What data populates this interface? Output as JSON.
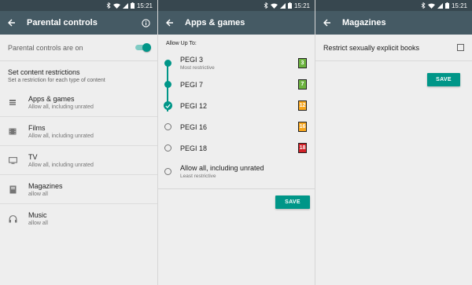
{
  "status_time": "15:21",
  "colors": {
    "status_bar": "#37474f",
    "app_bar": "#455a64",
    "accent": "#009688"
  },
  "panel1": {
    "title": "Parental controls",
    "toggle_label": "Parental controls are on",
    "toggle_on": true,
    "section_title": "Set content restrictions",
    "section_sub": "Set a restriction for each type of content",
    "items": [
      {
        "icon": "apps-icon",
        "label": "Apps & games",
        "sub": "Allow all, including unrated"
      },
      {
        "icon": "films-icon",
        "label": "Films",
        "sub": "Allow all, including unrated"
      },
      {
        "icon": "tv-icon",
        "label": "TV",
        "sub": "Allow all, including unrated"
      },
      {
        "icon": "book-icon",
        "label": "Magazines",
        "sub": "allow all"
      },
      {
        "icon": "headphones-icon",
        "label": "Music",
        "sub": "allow all"
      }
    ]
  },
  "panel2": {
    "title": "Apps & games",
    "allow_label": "Allow Up To:",
    "ratings": [
      {
        "label": "PEGI 3",
        "sub": "Most restrictive",
        "badge": "3",
        "badge_color": "#6cb33f"
      },
      {
        "label": "PEGI 7",
        "sub": "",
        "badge": "7",
        "badge_color": "#6cb33f"
      },
      {
        "label": "PEGI 12",
        "sub": "",
        "badge": "12",
        "badge_color": "#f7a51c"
      },
      {
        "label": "PEGI 16",
        "sub": "",
        "badge": "16",
        "badge_color": "#f7a51c"
      },
      {
        "label": "PEGI 18",
        "sub": "",
        "badge": "18",
        "badge_color": "#d12027"
      },
      {
        "label": "Allow all, including unrated",
        "sub": "Least restrictive",
        "badge": "",
        "badge_color": ""
      }
    ],
    "selected_index": 2,
    "save_label": "SAVE"
  },
  "panel3": {
    "title": "Magazines",
    "restrict_label": "Restrict sexually explicit books",
    "checked": false,
    "save_label": "SAVE"
  }
}
